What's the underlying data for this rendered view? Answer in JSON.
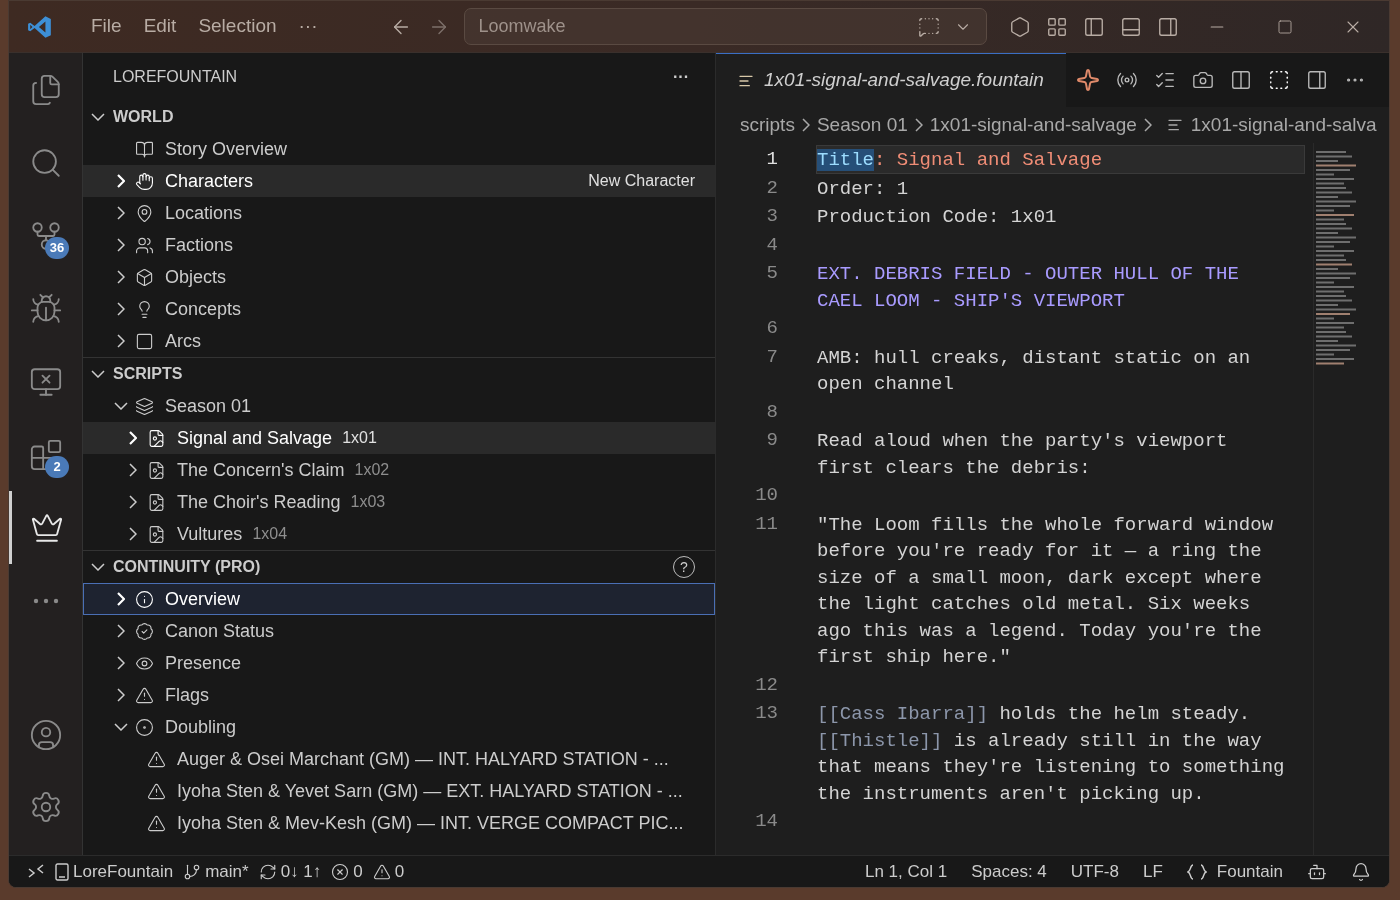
{
  "titlebar": {
    "menus": [
      "File",
      "Edit",
      "Selection",
      "···"
    ],
    "command_center": "Loomwake"
  },
  "activity_bar": [
    {
      "kind": "files",
      "selected": false
    },
    {
      "kind": "search",
      "selected": false
    },
    {
      "kind": "source-control",
      "selected": false,
      "badge": "36"
    },
    {
      "kind": "debug",
      "selected": false
    },
    {
      "kind": "remote",
      "selected": false
    },
    {
      "kind": "extensions",
      "selected": false,
      "badge": "2"
    },
    {
      "kind": "pawn",
      "selected": true
    },
    {
      "kind": "more",
      "selected": false
    }
  ],
  "activity_bottom": [
    {
      "kind": "account"
    },
    {
      "kind": "settings"
    }
  ],
  "sidebar": {
    "title": "LOREFOUNTAIN",
    "more": "···",
    "sections": [
      {
        "title": "WORLD",
        "expanded": true,
        "items": [
          {
            "label": "Story Overview",
            "kind": "book",
            "selected": false,
            "hovered": false
          },
          {
            "label": "Characters",
            "kind": "person",
            "expanded": false,
            "selected": false,
            "hovered": true,
            "action": "New Character"
          },
          {
            "label": "Locations",
            "kind": "pin",
            "expanded": false,
            "selected": false,
            "hovered": false
          },
          {
            "label": "Factions",
            "kind": "group",
            "expanded": false,
            "selected": false,
            "hovered": false
          },
          {
            "label": "Objects",
            "kind": "cube",
            "expanded": false,
            "selected": false,
            "hovered": false
          },
          {
            "label": "Concepts",
            "kind": "bulb",
            "expanded": false,
            "selected": false,
            "hovered": false
          },
          {
            "label": "Arcs",
            "kind": "square",
            "expanded": false,
            "selected": false,
            "hovered": false
          }
        ]
      },
      {
        "title": "SCRIPTS",
        "expanded": true,
        "items": [
          {
            "label": "Season 01",
            "kind": "layers",
            "expanded": true,
            "selected": false,
            "hovered": false,
            "children": [
              {
                "label": "Signal and Salvage",
                "code": "1x01",
                "kind": "script",
                "expanded": false,
                "selected": false,
                "hovered": true
              },
              {
                "label": "The Concern's Claim",
                "code": "1x02",
                "kind": "script",
                "expanded": false,
                "selected": false,
                "hovered": false
              },
              {
                "label": "The Choir's Reading",
                "code": "1x03",
                "kind": "script",
                "expanded": false,
                "selected": false,
                "hovered": false
              },
              {
                "label": "Vultures",
                "code": "1x04",
                "kind": "script",
                "expanded": false,
                "selected": false,
                "hovered": false
              }
            ]
          }
        ]
      },
      {
        "title": "CONTINUITY (PRO)",
        "expanded": true,
        "help": "?",
        "items": [
          {
            "label": "Overview",
            "kind": "info",
            "expanded": false,
            "selected": true,
            "hovered": false
          },
          {
            "label": "Canon Status",
            "kind": "badge",
            "expanded": false,
            "selected": false,
            "hovered": false
          },
          {
            "label": "Presence",
            "kind": "eye",
            "expanded": false,
            "selected": false,
            "hovered": false
          },
          {
            "label": "Flags",
            "kind": "warning",
            "expanded": false,
            "selected": false,
            "hovered": false
          },
          {
            "label": "Doubling",
            "kind": "dot",
            "expanded": true,
            "selected": false,
            "hovered": false,
            "children": [
              {
                "label": "Auger & Osei Marchant (GM) — INT. HALYARD STATION - ...",
                "kind": "warning",
                "selected": false,
                "hovered": false
              },
              {
                "label": "Iyoha Sten & Yevet Sarn (GM) — EXT. HALYARD STATION - ...",
                "kind": "warning",
                "selected": false,
                "hovered": false
              },
              {
                "label": "Iyoha Sten & Mev-Kesh (GM) — INT. VERGE COMPACT PIC...",
                "kind": "warning",
                "selected": false,
                "hovered": false
              }
            ]
          }
        ]
      }
    ]
  },
  "editor": {
    "tab": {
      "label": "1x01-signal-and-salvage.fountain",
      "selected": true
    },
    "breadcrumbs": [
      "scripts",
      "Season 01",
      "1x01-signal-and-salvage",
      "1x01-signal-and-salva"
    ],
    "lines": [
      {
        "number": "1",
        "current": true,
        "rows": [
          [
            {
              "kind": "key",
              "text": "Title"
            },
            {
              "kind": "value",
              "text": ": Signal and Salvage"
            }
          ]
        ]
      },
      {
        "number": "2",
        "current": false,
        "rows": [
          [
            {
              "kind": "plain",
              "text": "Order: 1"
            }
          ]
        ]
      },
      {
        "number": "3",
        "current": false,
        "rows": [
          [
            {
              "kind": "plain",
              "text": "Production Code: 1x01"
            }
          ]
        ]
      },
      {
        "number": "4",
        "current": false,
        "rows": [
          []
        ]
      },
      {
        "number": "5",
        "current": false,
        "rows": [
          [
            {
              "kind": "heading",
              "text": "EXT. DEBRIS FIELD - OUTER HULL OF THE"
            }
          ],
          [
            {
              "kind": "heading",
              "text": "CAEL LOOM - SHIP'S VIEWPORT"
            }
          ]
        ]
      },
      {
        "number": "6",
        "current": false,
        "rows": [
          []
        ]
      },
      {
        "number": "7",
        "current": false,
        "rows": [
          [
            {
              "kind": "plain",
              "text": "AMB: hull creaks, distant static on an"
            }
          ],
          [
            {
              "kind": "plain",
              "text": "open channel"
            }
          ]
        ]
      },
      {
        "number": "8",
        "current": false,
        "rows": [
          []
        ]
      },
      {
        "number": "9",
        "current": false,
        "rows": [
          [
            {
              "kind": "plain",
              "text": "Read aloud when the party's viewport"
            }
          ],
          [
            {
              "kind": "plain",
              "text": "first clears the debris:"
            }
          ]
        ]
      },
      {
        "number": "10",
        "current": false,
        "rows": [
          []
        ]
      },
      {
        "number": "11",
        "current": false,
        "rows": [
          [
            {
              "kind": "plain",
              "text": "\"The Loom fills the whole forward window"
            }
          ],
          [
            {
              "kind": "plain",
              "text": "before you're ready for it — a ring the"
            }
          ],
          [
            {
              "kind": "plain",
              "text": "size of a small moon, dark except where"
            }
          ],
          [
            {
              "kind": "plain",
              "text": "the light catches old metal. Six weeks"
            }
          ],
          [
            {
              "kind": "plain",
              "text": "ago this was a legend. Today you're the"
            }
          ],
          [
            {
              "kind": "plain",
              "text": "first ship here.\""
            }
          ]
        ]
      },
      {
        "number": "12",
        "current": false,
        "rows": [
          []
        ]
      },
      {
        "number": "13",
        "current": false,
        "rows": [
          [
            {
              "kind": "link",
              "text": "[[Cass Ibarra]]"
            },
            {
              "kind": "plain",
              "text": " holds the helm steady."
            }
          ],
          [
            {
              "kind": "link",
              "text": "[[Thistle]]"
            },
            {
              "kind": "plain",
              "text": " is already still in the way"
            }
          ],
          [
            {
              "kind": "plain",
              "text": "that means they're listening to something"
            }
          ],
          [
            {
              "kind": "plain",
              "text": "the instruments aren't picking up."
            }
          ]
        ]
      },
      {
        "number": "14",
        "current": false,
        "rows": [
          []
        ]
      }
    ]
  },
  "status_bar": {
    "left": [
      {
        "kind": "remote"
      },
      {
        "kind": "project",
        "text": "LoreFountain"
      },
      {
        "kind": "branch",
        "text": "main*"
      },
      {
        "kind": "sync",
        "text": "0↓ 1↑"
      },
      {
        "kind": "errors",
        "text": "0"
      },
      {
        "kind": "warnings",
        "text": "0"
      }
    ],
    "right": [
      {
        "kind": "text",
        "text": "Ln 1, Col 1"
      },
      {
        "kind": "text",
        "text": "Spaces: 4"
      },
      {
        "kind": "text",
        "text": "UTF-8"
      },
      {
        "kind": "text",
        "text": "LF"
      },
      {
        "kind": "language",
        "text": "Fountain"
      },
      {
        "kind": "copilot"
      },
      {
        "kind": "bell"
      }
    ]
  }
}
